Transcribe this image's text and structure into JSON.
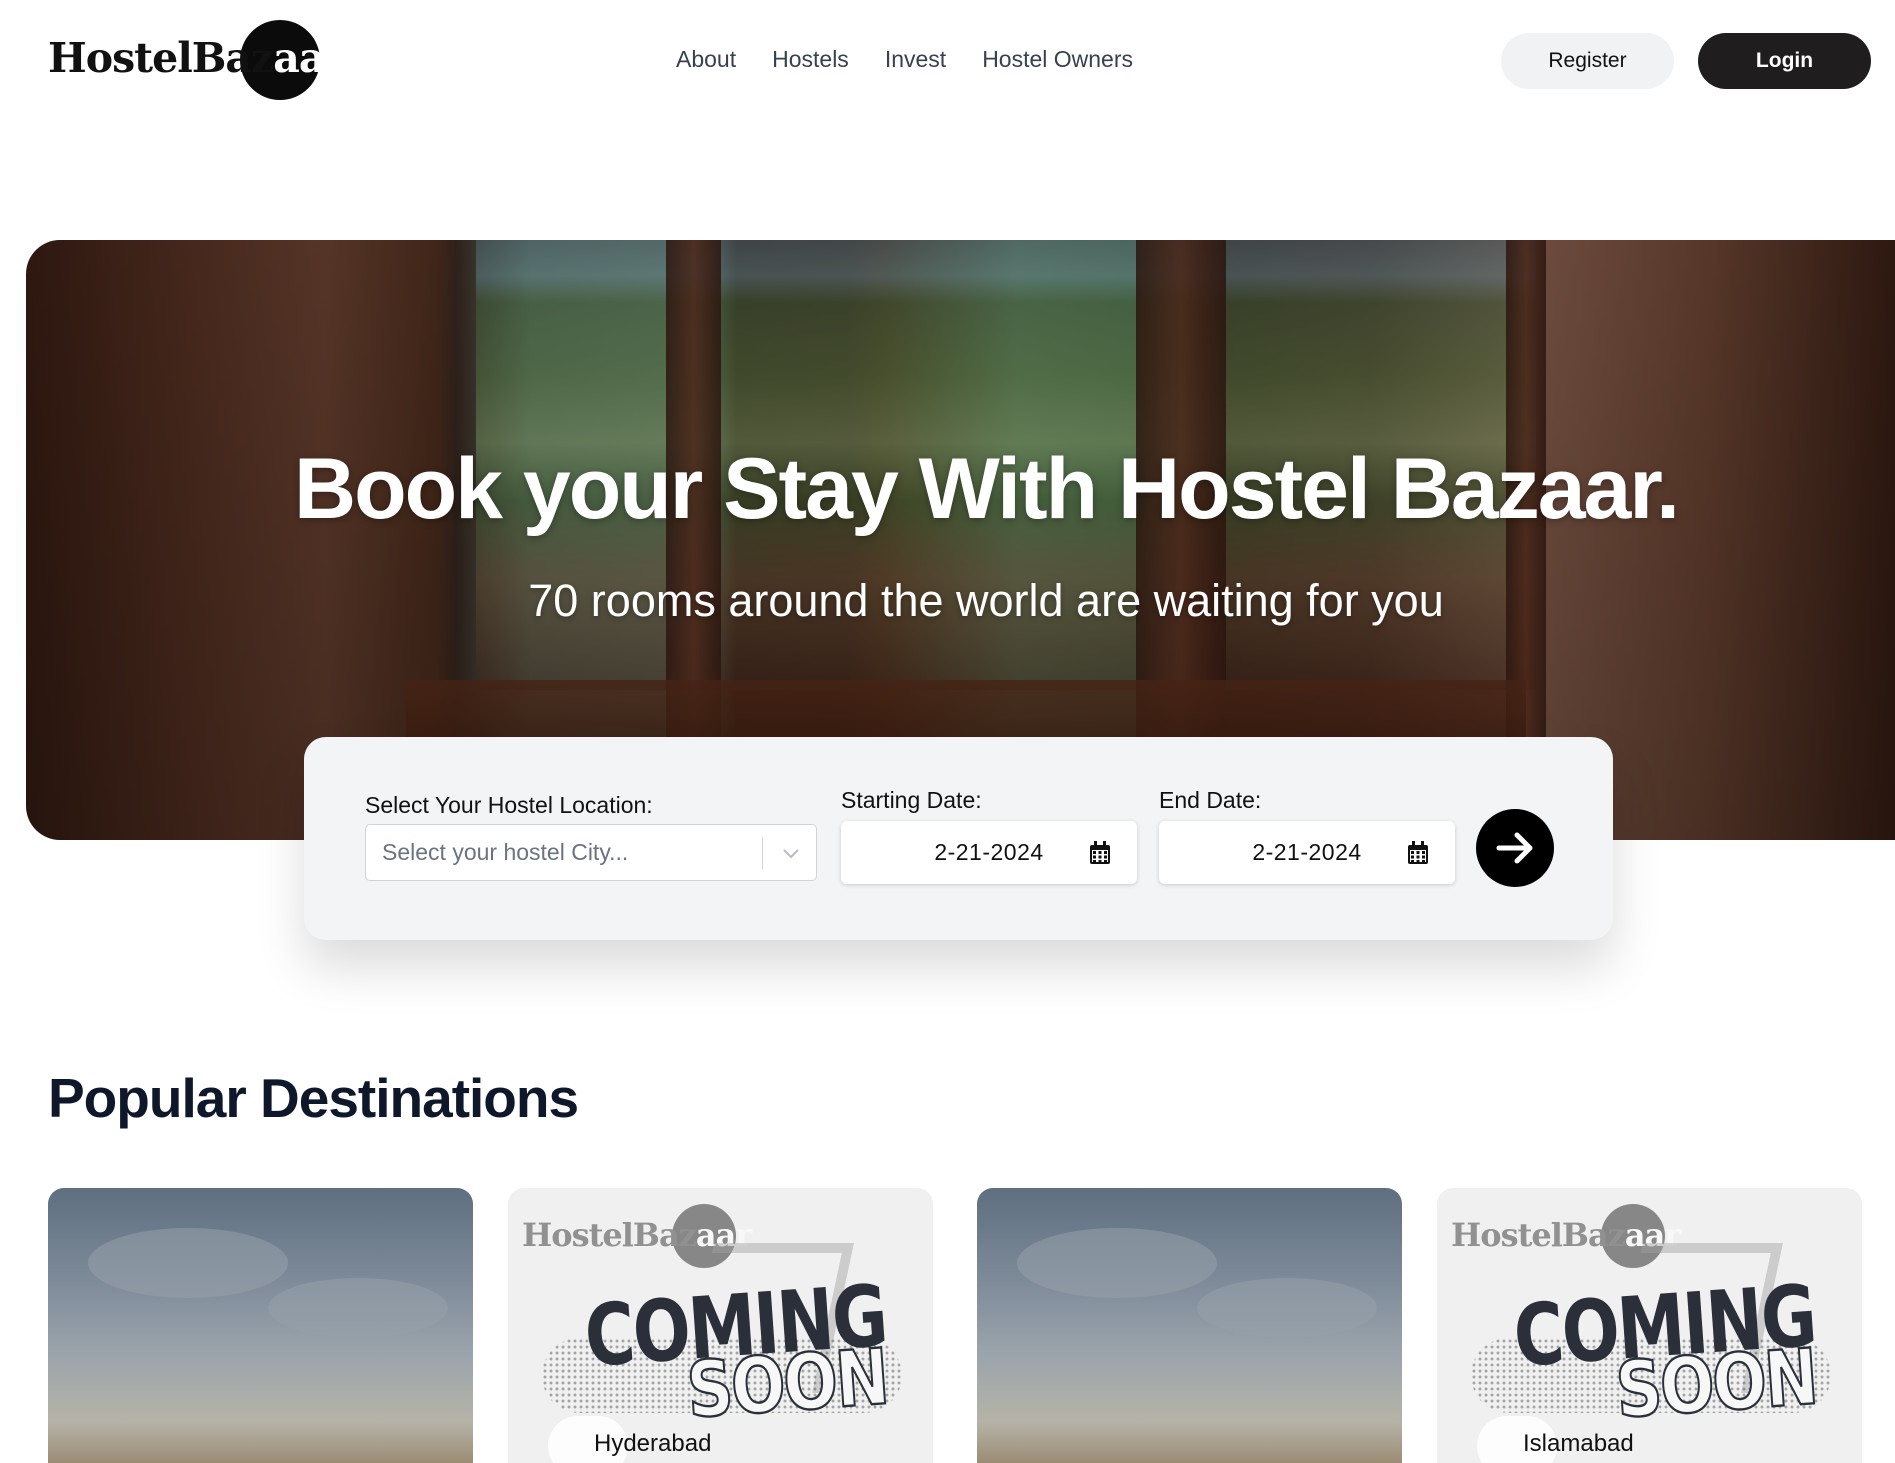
{
  "header": {
    "logo": {
      "text_dark": "HostelBaz",
      "text_light": "aar"
    },
    "nav": [
      "About",
      "Hostels",
      "Invest",
      "Hostel Owners"
    ],
    "register_label": "Register",
    "login_label": "Login"
  },
  "hero": {
    "title": "Book your Stay With Hostel Bazaar.",
    "subtitle": "70 rooms around the world are waiting for you"
  },
  "search": {
    "location_label": "Select Your Hostel Location:",
    "location_placeholder": "Select your hostel City...",
    "start_label": "Starting Date:",
    "start_value": "2-21-2024",
    "end_label": "End Date:",
    "end_value": "2-21-2024"
  },
  "popular": {
    "title": "Popular Destinations",
    "cards": [
      {
        "type": "photo",
        "city": ""
      },
      {
        "type": "coming-soon",
        "city": "Hyderabad",
        "soon_line1": "COMING",
        "soon_line2": "SOON"
      },
      {
        "type": "photo",
        "city": ""
      },
      {
        "type": "coming-soon",
        "city": "Islamabad",
        "soon_line1": "COMING",
        "soon_line2": "SOON"
      }
    ]
  },
  "colors": {
    "accent": "#1f1d1d",
    "register_bg": "#f1f2f4",
    "search_card_bg": "#f3f4f6",
    "heading": "#0f172a"
  },
  "icons": [
    "chevron-down-icon",
    "calendar-icon",
    "arrow-right-icon"
  ]
}
